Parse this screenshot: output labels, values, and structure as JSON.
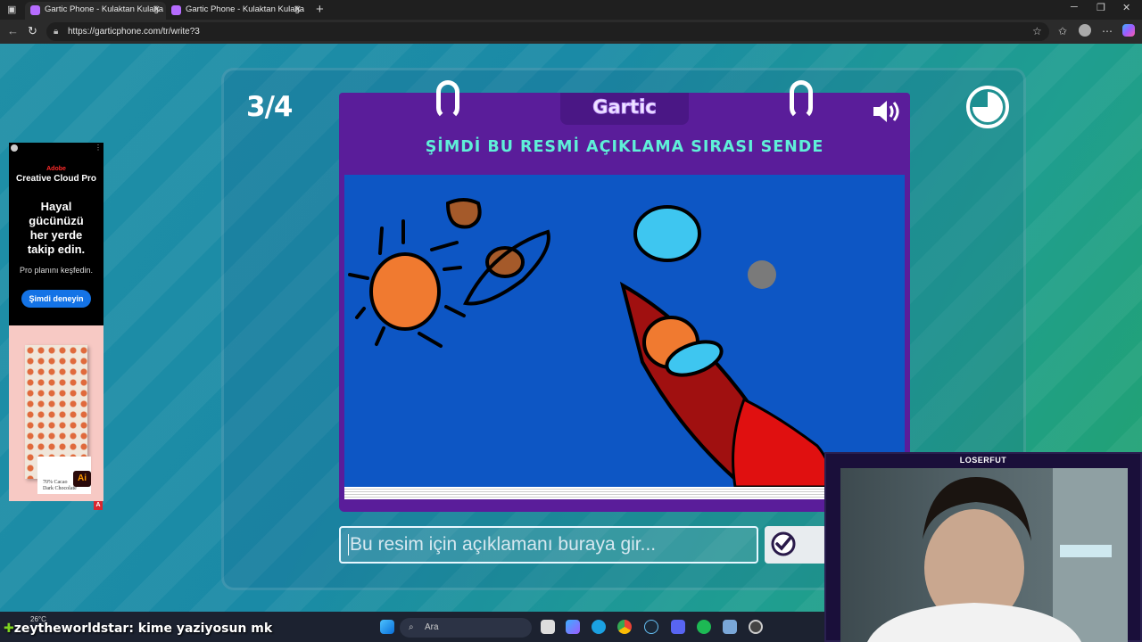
{
  "browser": {
    "tabs": [
      {
        "title": "Gartic Phone - Kulaktan Kulağa",
        "active": true
      },
      {
        "title": "Gartic Phone - Kulaktan Kulağa",
        "active": false
      }
    ],
    "url": "https://garticphone.com/tr/write?3"
  },
  "game": {
    "round": "3/4",
    "logo": "Gartic",
    "headline": "ŞİMDİ BU RESMİ AÇIKLAMA SIRASI SENDE",
    "input_placeholder": "Bu resim için açıklamanı buraya gir..."
  },
  "ad": {
    "brand_line1": "Adobe",
    "brand_line2": "Creative Cloud Pro",
    "headline_1": "Hayal",
    "headline_2": "gücünüzü",
    "headline_3": "her yerde",
    "headline_4": "takip edin.",
    "subtext": "Pro planını keşfedin.",
    "cta": "Şimdi deneyin",
    "product_text_1": "70% Cacao",
    "product_text_2": "Dark Chocolate",
    "app_badge": "Ai",
    "ad_marker": "A"
  },
  "stream": {
    "cam_title": "LOSERFUT",
    "chat_user": "zeytheworldstar",
    "chat_message": ": kime yaziyosun mk"
  },
  "taskbar": {
    "weather": "26°C",
    "search_label": "Ara"
  },
  "colors": {
    "sheet_purple": "#5a1d9a",
    "canvas_blue": "#0d56c4",
    "headline_teal": "#5ff0d8"
  }
}
